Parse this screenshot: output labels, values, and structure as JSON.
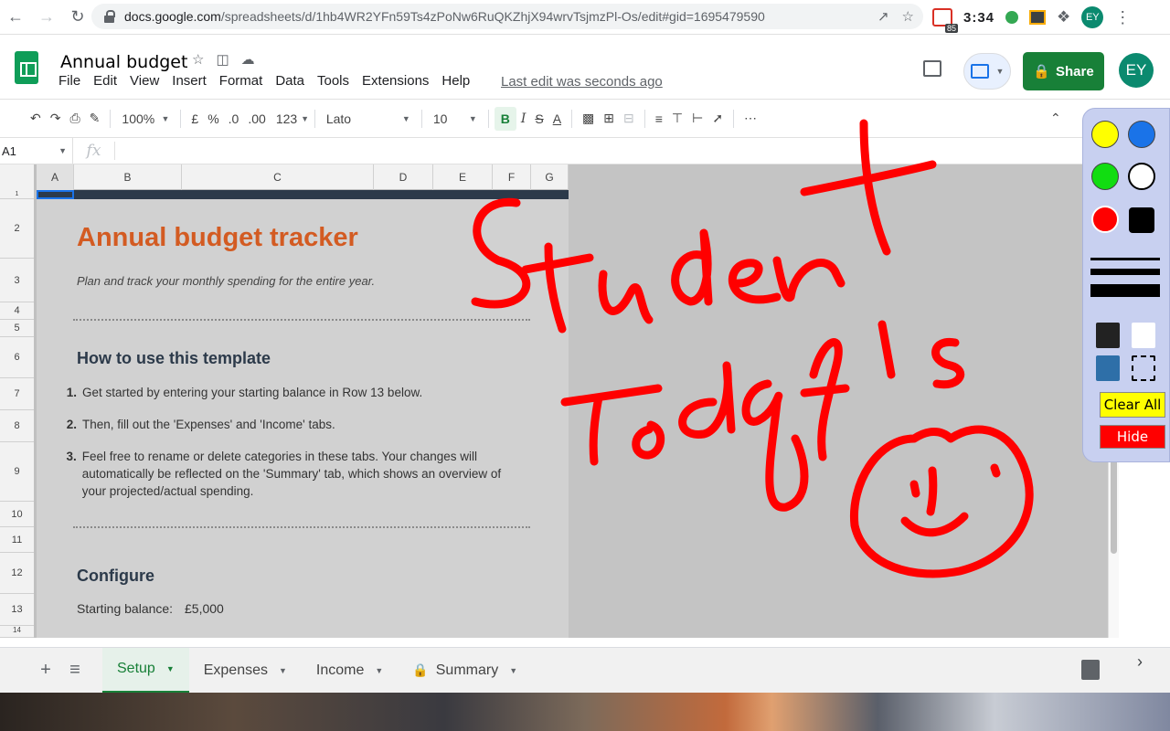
{
  "browser": {
    "url_host": "docs.google.com",
    "url_path": "/spreadsheets/d/1hb4WR2YFn59Ts4zPoNw6RuQKZhjX94wrvTsjmzPl-Os/edit#gid=1695479590",
    "ext_badge_count": "85",
    "clock": "3:34",
    "avatar_initials": "EY"
  },
  "header": {
    "doc_title": "Annual budget",
    "menus": [
      "File",
      "Edit",
      "View",
      "Insert",
      "Format",
      "Data",
      "Tools",
      "Extensions",
      "Help"
    ],
    "last_edit": "Last edit was seconds ago",
    "share_label": "Share",
    "avatar_initials": "EY"
  },
  "toolbar": {
    "zoom": "100%",
    "currency": "£",
    "percent": "%",
    "decimal_decrease": ".0",
    "decimal_increase": ".00",
    "more_formats": "123",
    "font": "Lato",
    "font_size": "10",
    "bold": "B",
    "italic": "I",
    "strike": "S",
    "text_color": "A"
  },
  "formula_bar": {
    "cell_ref": "A1",
    "fx": "fx",
    "content": ""
  },
  "grid": {
    "columns": [
      "A",
      "B",
      "C",
      "D",
      "E",
      "F",
      "G"
    ],
    "rows": [
      "1",
      "2",
      "3",
      "4",
      "5",
      "6",
      "7",
      "8",
      "9",
      "10",
      "11",
      "12",
      "13",
      "14"
    ]
  },
  "sheet": {
    "title": "Annual budget tracker",
    "subtitle": "Plan and track your monthly spending for the entire year.",
    "how_to_heading": "How to use this template",
    "steps": [
      {
        "num": "1.",
        "text": "Get started by entering your starting balance in Row 13 below."
      },
      {
        "num": "2.",
        "text": "Then, fill out the 'Expenses' and 'Income' tabs."
      },
      {
        "num": "3.",
        "text": "Feel free to rename or delete categories in these tabs. Your changes will automatically be reflected on the 'Summary' tab, which shows an overview of your projected/actual spending."
      }
    ],
    "configure_heading": "Configure",
    "starting_balance_label": "Starting balance:",
    "starting_balance_value": "£5,000"
  },
  "tabs": [
    {
      "label": "Setup",
      "active": true
    },
    {
      "label": "Expenses",
      "active": false
    },
    {
      "label": "Income",
      "active": false
    },
    {
      "label": "Summary",
      "active": false,
      "locked": true
    }
  ],
  "annotation_tool": {
    "clear_label": "Clear All",
    "hide_label": "Hide",
    "colors": [
      "#ffff00",
      "#1a73e8",
      "#11dd11",
      "#ffffff",
      "#ff0000",
      "#000000"
    ],
    "ink_color": "#ff0000"
  },
  "colors": {
    "sheets_green": "#0f9d58",
    "share_green": "#188038",
    "title_orange": "#d35b22",
    "heading_navy": "#2c3a4a"
  }
}
